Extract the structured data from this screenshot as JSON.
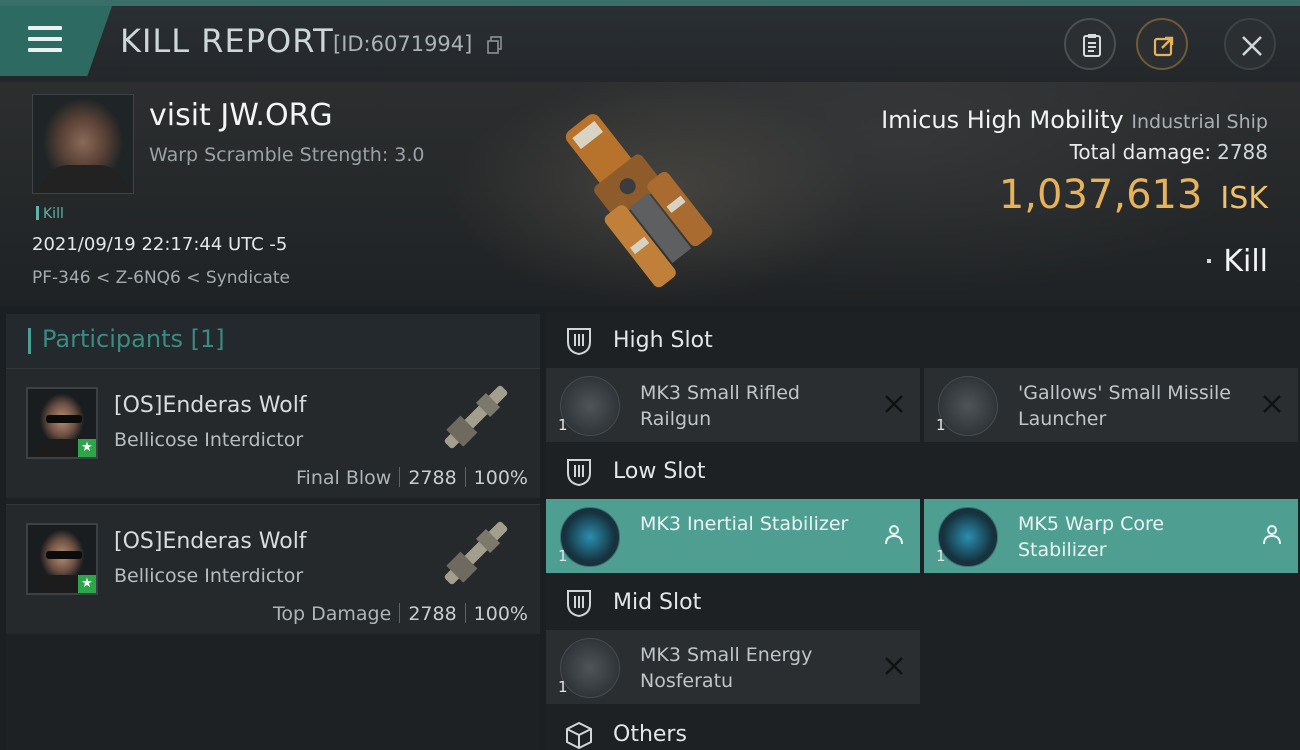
{
  "header": {
    "title": "KILL REPORT",
    "report_id": "[ID:6071994]"
  },
  "victim": {
    "name": "visit JW.ORG",
    "warp_scramble": "Warp Scramble Strength: 3.0",
    "kill_tag": "Kill",
    "timestamp": "2021/09/19 22:17:44 UTC -5",
    "location": "PF-346 < Z-6NQ6 < Syndicate"
  },
  "ship": {
    "name": "Imicus High Mobility",
    "class": "Industrial Ship",
    "total_damage_label": "Total damage:",
    "total_damage_value": "2788",
    "isk_value": "1,037,613",
    "isk_unit": "ISK",
    "result": "Kill"
  },
  "participants": {
    "header": "Participants [1]",
    "cards": [
      {
        "name": "[OS]Enderas Wolf",
        "ship": "Bellicose Interdictor",
        "label": "Final Blow",
        "damage": "2788",
        "percent": "100%"
      },
      {
        "name": "[OS]Enderas Wolf",
        "ship": "Bellicose Interdictor",
        "label": "Top Damage",
        "damage": "2788",
        "percent": "100%"
      }
    ]
  },
  "fitting": {
    "high_slot": {
      "label": "High Slot",
      "modules": [
        {
          "name": "MK3 Small Rifled Railgun",
          "qty": "1",
          "state": "destroyed"
        },
        {
          "name": "'Gallows' Small Missile Launcher",
          "qty": "1",
          "state": "destroyed"
        }
      ]
    },
    "low_slot": {
      "label": "Low Slot",
      "modules": [
        {
          "name": "MK3 Inertial Stabilizer",
          "qty": "1",
          "state": "dropped"
        },
        {
          "name": "MK5 Warp Core Stabilizer",
          "qty": "1",
          "state": "dropped"
        }
      ]
    },
    "mid_slot": {
      "label": "Mid Slot",
      "modules": [
        {
          "name": "MK3 Small Energy Nosferatu",
          "qty": "1",
          "state": "destroyed"
        }
      ]
    },
    "others": {
      "label": "Others"
    }
  },
  "colors": {
    "accent_teal": "#4f9e92",
    "isk_gold": "#e6b25c",
    "background": "#1b1f22"
  }
}
